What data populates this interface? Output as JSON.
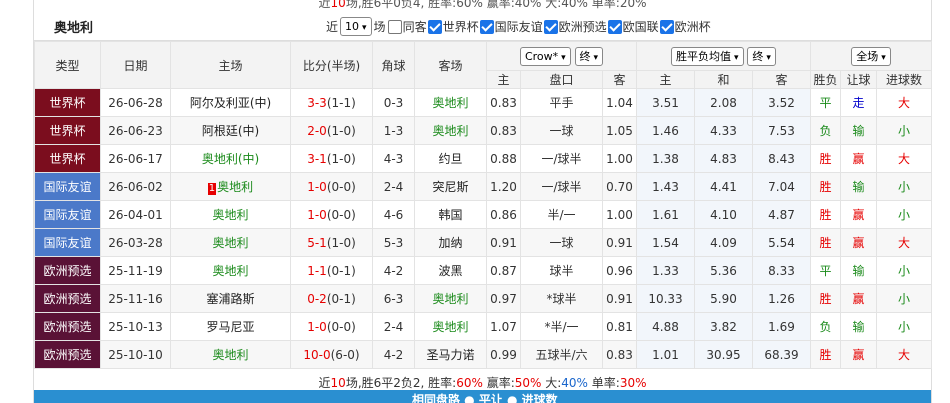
{
  "top_line": {
    "prefix": "近",
    "n": "10",
    "text1": "场,胜6平0负4, 胜率:",
    "win": "60%",
    "text2": " 赢率:",
    "ying": "40%",
    "text3": " 大:",
    "big": "40%",
    "text4": " 单率:",
    "odd": "20%"
  },
  "toolbar": {
    "title": "奥地利",
    "recent_label": "近",
    "recent_value": "10",
    "games_label": "场",
    "checks": [
      {
        "label": "同客",
        "checked": false
      },
      {
        "label": "世界杯",
        "checked": true
      },
      {
        "label": "国际友谊",
        "checked": true
      },
      {
        "label": "欧洲预选",
        "checked": true
      },
      {
        "label": "欧国联",
        "checked": true
      },
      {
        "label": "欧洲杯",
        "checked": true
      }
    ]
  },
  "headers": {
    "league": "类型",
    "date": "日期",
    "home": "主场",
    "score": "比分(半场)",
    "corner": "角球",
    "away": "客场",
    "handicap_company": "Crow*",
    "handicap_stage": "终",
    "odds_type": "胜平负均值",
    "odds_stage": "终",
    "filter": "全场",
    "sub_home": "主",
    "sub_line": "盘口",
    "sub_away": "客",
    "sub_w": "主",
    "sub_d": "和",
    "sub_l": "客",
    "result": "胜负",
    "cover": "让球",
    "goals": "进球数"
  },
  "colors": {
    "worldcup": "#7b0d1e",
    "friendly": "#4b79c9",
    "euroqual": "#5a1236"
  },
  "rows": [
    {
      "league": "世界杯",
      "ltype": "worldcup",
      "date": "26-06-28",
      "home": "阿尔及利亚(中)",
      "hc": "dark",
      "score": "3-3",
      "half": "(1-1)",
      "corner": "0-3",
      "away": "奥地利",
      "ac": "green",
      "ho": "0.83",
      "line": "平手",
      "ao": "1.04",
      "w": "3.51",
      "d": "2.08",
      "l": "3.52",
      "res": "平",
      "resc": "green",
      "cov": "走",
      "covc": "blue",
      "gl": "大",
      "glc": "red"
    },
    {
      "league": "世界杯",
      "ltype": "worldcup",
      "date": "26-06-23",
      "home": "阿根廷(中)",
      "hc": "dark",
      "score": "2-0",
      "half": "(1-0)",
      "corner": "1-3",
      "away": "奥地利",
      "ac": "green",
      "ho": "0.83",
      "line": "一球",
      "ao": "1.05",
      "w": "1.46",
      "d": "4.33",
      "l": "7.53",
      "res": "负",
      "resc": "green",
      "cov": "输",
      "covc": "green",
      "gl": "小",
      "glc": "green"
    },
    {
      "league": "世界杯",
      "ltype": "worldcup",
      "date": "26-06-17",
      "home": "奥地利(中)",
      "hc": "green",
      "score": "3-1",
      "half": "(1-0)",
      "corner": "4-3",
      "away": "约旦",
      "ac": "dark",
      "ho": "0.88",
      "line": "一/球半",
      "ao": "1.00",
      "w": "1.38",
      "d": "4.83",
      "l": "8.43",
      "res": "胜",
      "resc": "red",
      "cov": "赢",
      "covc": "red",
      "gl": "大",
      "glc": "red"
    },
    {
      "league": "国际友谊",
      "ltype": "friendly",
      "date": "26-06-02",
      "home": "奥地利",
      "rank": "1",
      "hc": "green",
      "score": "1-0",
      "half": "(0-0)",
      "corner": "2-4",
      "away": "突尼斯",
      "ac": "dark",
      "ho": "1.20",
      "line": "一/球半",
      "ao": "0.70",
      "w": "1.43",
      "d": "4.41",
      "l": "7.04",
      "res": "胜",
      "resc": "red",
      "cov": "输",
      "covc": "green",
      "gl": "小",
      "glc": "green"
    },
    {
      "league": "国际友谊",
      "ltype": "friendly",
      "date": "26-04-01",
      "home": "奥地利",
      "hc": "green",
      "score": "1-0",
      "half": "(0-0)",
      "corner": "4-6",
      "away": "韩国",
      "ac": "dark",
      "ho": "0.86",
      "line": "半/一",
      "ao": "1.00",
      "w": "1.61",
      "d": "4.10",
      "l": "4.87",
      "res": "胜",
      "resc": "red",
      "cov": "赢",
      "covc": "red",
      "gl": "小",
      "glc": "green"
    },
    {
      "league": "国际友谊",
      "ltype": "friendly",
      "date": "26-03-28",
      "home": "奥地利",
      "hc": "green",
      "score": "5-1",
      "half": "(1-0)",
      "corner": "5-3",
      "away": "加纳",
      "ac": "dark",
      "ho": "0.91",
      "line": "一球",
      "ao": "0.91",
      "w": "1.54",
      "d": "4.09",
      "l": "5.54",
      "res": "胜",
      "resc": "red",
      "cov": "赢",
      "covc": "red",
      "gl": "大",
      "glc": "red"
    },
    {
      "league": "欧洲预选",
      "ltype": "euroqual",
      "date": "25-11-19",
      "home": "奥地利",
      "hc": "green",
      "score": "1-1",
      "half": "(0-1)",
      "corner": "4-2",
      "away": "波黑",
      "ac": "dark",
      "ho": "0.87",
      "line": "球半",
      "ao": "0.96",
      "w": "1.33",
      "d": "5.36",
      "l": "8.33",
      "res": "平",
      "resc": "green",
      "cov": "输",
      "covc": "green",
      "gl": "小",
      "glc": "green"
    },
    {
      "league": "欧洲预选",
      "ltype": "euroqual",
      "date": "25-11-16",
      "home": "塞浦路斯",
      "hc": "dark",
      "score": "0-2",
      "half": "(0-1)",
      "corner": "6-3",
      "away": "奥地利",
      "ac": "green",
      "ho": "0.97",
      "line": "*球半",
      "ao": "0.91",
      "w": "10.33",
      "d": "5.90",
      "l": "1.26",
      "res": "胜",
      "resc": "red",
      "cov": "赢",
      "covc": "red",
      "gl": "小",
      "glc": "green"
    },
    {
      "league": "欧洲预选",
      "ltype": "euroqual",
      "date": "25-10-13",
      "home": "罗马尼亚",
      "hc": "dark",
      "score": "1-0",
      "half": "(0-0)",
      "corner": "2-4",
      "away": "奥地利",
      "ac": "green",
      "ho": "1.07",
      "line": "*半/一",
      "ao": "0.81",
      "w": "4.88",
      "d": "3.82",
      "l": "1.69",
      "res": "负",
      "resc": "green",
      "cov": "输",
      "covc": "green",
      "gl": "小",
      "glc": "green"
    },
    {
      "league": "欧洲预选",
      "ltype": "euroqual",
      "date": "25-10-10",
      "home": "奥地利",
      "hc": "green",
      "score": "10-0",
      "half": "(6-0)",
      "corner": "4-2",
      "away": "圣马力诺",
      "ac": "dark",
      "ho": "0.99",
      "line": "五球半/六",
      "ao": "0.83",
      "w": "1.01",
      "d": "30.95",
      "l": "68.39",
      "res": "胜",
      "resc": "red",
      "cov": "赢",
      "covc": "red",
      "gl": "大",
      "glc": "red"
    }
  ],
  "summary": {
    "prefix": "近",
    "n": "10",
    "t1": "场,胜6平2负2, 胜率:",
    "win": "60%",
    "t2": " 赢率:",
    "ying": "50%",
    "t3": " 大:",
    "big": "40%",
    "t4": " 单率:",
    "odd": "30%"
  },
  "bottom_bar": {
    "text": "相同盘路 ● 平让 ● 进球数"
  }
}
